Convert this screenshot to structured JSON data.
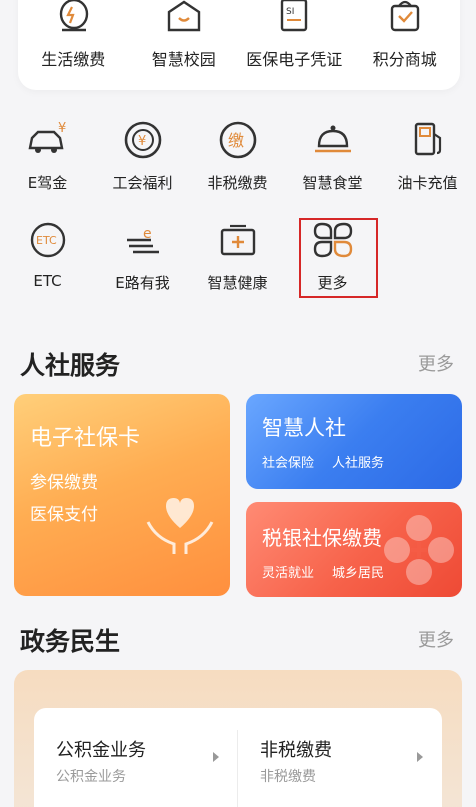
{
  "top_services": [
    {
      "label": "生活缴费",
      "icon": "life-payment-icon"
    },
    {
      "label": "智慧校园",
      "icon": "smart-campus-icon"
    },
    {
      "label": "医保电子凭证",
      "icon": "medical-voucher-icon"
    },
    {
      "label": "积分商城",
      "icon": "points-mall-icon"
    }
  ],
  "grid_row1": [
    {
      "label": "E驾金",
      "icon": "car-yuan-icon"
    },
    {
      "label": "工会福利",
      "icon": "union-welfare-icon"
    },
    {
      "label": "非税缴费",
      "icon": "non-tax-payment-icon"
    },
    {
      "label": "智慧食堂",
      "icon": "cloche-icon"
    },
    {
      "label": "油卡充值",
      "icon": "fuel-pump-icon"
    }
  ],
  "grid_row2": [
    {
      "label": "ETC",
      "icon": "etc-icon"
    },
    {
      "label": "E路有我",
      "icon": "road-e-icon"
    },
    {
      "label": "智慧健康",
      "icon": "health-kit-icon"
    },
    {
      "label": "更多",
      "icon": "more-clover-icon"
    }
  ],
  "section_social": {
    "title": "人社服务",
    "more": "更多"
  },
  "card_ebk": {
    "title": "电子社保卡",
    "line1": "参保缴费",
    "line2": "医保支付"
  },
  "card_zh": {
    "title": "智慧人社",
    "sub1": "社会保险",
    "sub2": "人社服务"
  },
  "card_sy": {
    "title": "税银社保缴费",
    "sub1": "灵活就业",
    "sub2": "城乡居民"
  },
  "section_gov": {
    "title": "政务民生",
    "more": "更多"
  },
  "gov_items": [
    {
      "title": "公积金业务",
      "sub": "公积金业务"
    },
    {
      "title": "非税缴费",
      "sub": "非税缴费"
    }
  ],
  "colors": {
    "accent_orange": "#e08a3a",
    "highlight_red": "#d62727",
    "blue_card": "#3b7ef0",
    "red_card": "#f7624a",
    "orange_card": "#ffad52"
  }
}
